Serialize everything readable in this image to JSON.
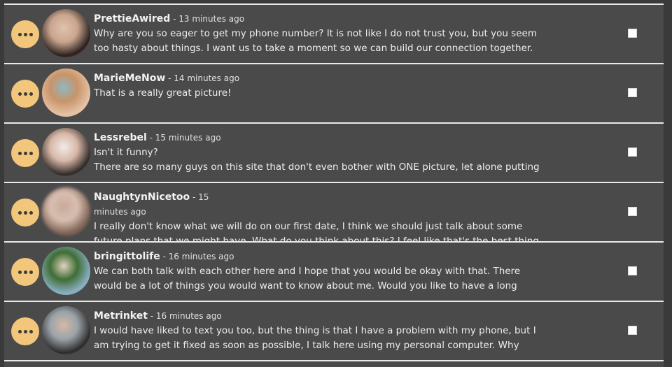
{
  "messages": [
    {
      "username": "PrettieAwired",
      "separator": " - ",
      "time": "13 minutes ago",
      "text": "Why are you so eager to get my phone number? It is not like I do not trust you, but you seem too hasty about things. I want us to take a moment so we can build our connection together.",
      "avatar_colors": [
        "#c9a58e",
        "#2a1f1c",
        "#e1c2ad"
      ],
      "checked": false
    },
    {
      "username": "MarieMeNow",
      "separator": " - ",
      "time": "14 minutes ago",
      "text": "That is a really great picture!",
      "avatar_colors": [
        "#c79468",
        "#e6c3a8",
        "#8fb8c4"
      ],
      "checked": false
    },
    {
      "username": "Lessrebel",
      "separator": " - ",
      "time": "15 minutes ago",
      "text": "Isn't it funny?\nThere are so many guys on this site that don't even bother with ONE picture, let alone putting up",
      "avatar_colors": [
        "#d8b7a6",
        "#2f2a28",
        "#f0ece8"
      ],
      "checked": false
    },
    {
      "username": "NaughtynNicetoo",
      "separator": " - ",
      "time": "15 minutes ago",
      "text": "I really don't know what we will do on our first date, I think we should just talk about some future plans that we might have. What do you think about this? I feel like that's the best thing for us at",
      "avatar_colors": [
        "#d9c0b2",
        "#7a5e50",
        "#c8a898"
      ],
      "avatar_blurred": true,
      "checked": false
    },
    {
      "username": "bringittolife",
      "separator": " - ",
      "time": "16 minutes ago",
      "text": "We can both talk with each other here and I hope that you would be okay with that. There would be a lot of things you would want to know about me. Would you like to have a long term",
      "avatar_colors": [
        "#3f6e35",
        "#8cb0c8",
        "#e2d2bf"
      ],
      "checked": false
    },
    {
      "username": "Metrinket",
      "separator": " - ",
      "time": "16 minutes ago",
      "text": "I would have liked to text you too, but the thing is that I have a problem with my phone, but I am trying to get it fixed as soon as possible, I talk here using my personal computer. Why can't we",
      "avatar_colors": [
        "#9aa3a8",
        "#2b2b2b",
        "#d6b8a8"
      ],
      "checked": false
    }
  ],
  "icons": {
    "menu": "more-horizontal-icon"
  },
  "colors": {
    "background": "#3a3a3a",
    "row": "#4a4a4a",
    "divider": "#eaeaea",
    "menu_button": "#f3c77b",
    "text": "#eeeeee"
  }
}
